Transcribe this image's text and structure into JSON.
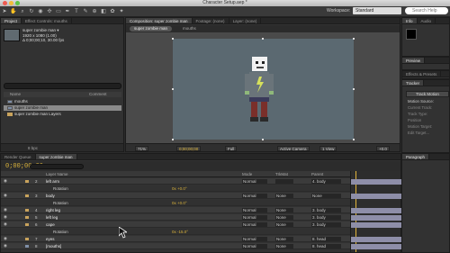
{
  "window": {
    "title": "Character Setup.aep *"
  },
  "toolbar": {
    "tools": [
      "hand-tool",
      "zoom-tool",
      "rotate-tool",
      "camera-tool",
      "pan-behind-tool",
      "rectangle-tool",
      "pen-tool",
      "text-tool",
      "brush-tool",
      "clone-tool",
      "eraser-tool",
      "roto-brush-tool",
      "puppet-tool"
    ],
    "workspace_label": "Workspace:",
    "workspace_value": "Standard",
    "search_placeholder": "Search Help"
  },
  "project_panel": {
    "tabs": [
      "Project",
      "Effect Controls: mouths"
    ],
    "comp_name": "super zombie man ▾",
    "comp_size": "1920 x 1080 (1.00)",
    "comp_duration": "Δ 0;00;00;10, 30.00 fps",
    "header_name": "Name",
    "header_comment": "Comment",
    "items": [
      {
        "name": "mouths",
        "type": "comp"
      },
      {
        "name": "super zombie man",
        "type": "comp",
        "selected": true
      },
      {
        "name": "super zombie man Layers",
        "type": "folder"
      }
    ],
    "bpc": "8 bpc"
  },
  "composition_panel": {
    "tabs": [
      "Composition: super zombie man",
      "Footage: (none)",
      "Layer: (none)"
    ],
    "breadcrumbs": [
      "super zombie man",
      "mouths"
    ],
    "zoom": "71%",
    "timecode": "0;00;00;00",
    "resolution": "Full",
    "camera": "Active Camera",
    "views": "1 View",
    "exposure": "+0.0"
  },
  "info_panel": {
    "tabs": [
      "Info",
      "Audio"
    ]
  },
  "preview_panel": {
    "title": "Preview"
  },
  "effects_panel": {
    "title": "Effects & Presets"
  },
  "tracker_panel": {
    "title": "Tracker",
    "track_motion": "Track Motion",
    "stabilize": "Stabilize Motion",
    "motion_source_label": "Motion Source:",
    "motion_source_value": "None",
    "current_track": "Current Track:",
    "track_type": "Track Type:",
    "position": "Position",
    "rotation": "Rotation",
    "motion_target": "Motion Target:",
    "edit_target": "Edit Target..."
  },
  "timeline_panel": {
    "tabs": [
      "Render Queue",
      "super zombie man"
    ],
    "timecode": "0;00;00;00",
    "columns": {
      "name": "Layer Name",
      "mode": "Mode",
      "trkmat": "TrkMat",
      "parent": "Parent"
    },
    "rows": [
      {
        "num": "2",
        "name": "left arm",
        "label": "#c9a35c",
        "top": true,
        "mode": "Normal",
        "trk": "",
        "parent": "4. body"
      },
      {
        "sub": "Rotation",
        "value": "0x +0.0°"
      },
      {
        "num": "3",
        "name": "body",
        "label": "#c9a35c",
        "top": true,
        "mode": "Normal",
        "trk": "None",
        "parent": "None"
      },
      {
        "sub": "Rotation",
        "value": "0x +0.0°"
      },
      {
        "num": "4",
        "name": "right leg",
        "label": "#c9a35c",
        "top": true,
        "mode": "Normal",
        "trk": "None",
        "parent": "3. body"
      },
      {
        "num": "5",
        "name": "left leg",
        "label": "#c9a35c",
        "top": true,
        "mode": "Normal",
        "trk": "None",
        "parent": "3. body"
      },
      {
        "num": "6",
        "name": "cape",
        "label": "#c9a35c",
        "top": true,
        "mode": "Normal",
        "trk": "None",
        "parent": "3. body"
      },
      {
        "sub": "Rotation",
        "value": "0x -15.0°"
      },
      {
        "num": "7",
        "name": "eyes",
        "label": "#c9a35c",
        "top": true,
        "mode": "Normal",
        "trk": "None",
        "parent": "8. head"
      },
      {
        "num": "8",
        "name": "[mouths]",
        "label": "#7f8fa8",
        "top": true,
        "mode": "Normal",
        "trk": "None",
        "parent": "8. head"
      }
    ]
  },
  "paragraph_panel": {
    "title": "Paragraph"
  },
  "colors": {
    "timecode": "#d9b23b",
    "label_yellow": "#c9a35c",
    "selection": "#8a8a8a"
  }
}
